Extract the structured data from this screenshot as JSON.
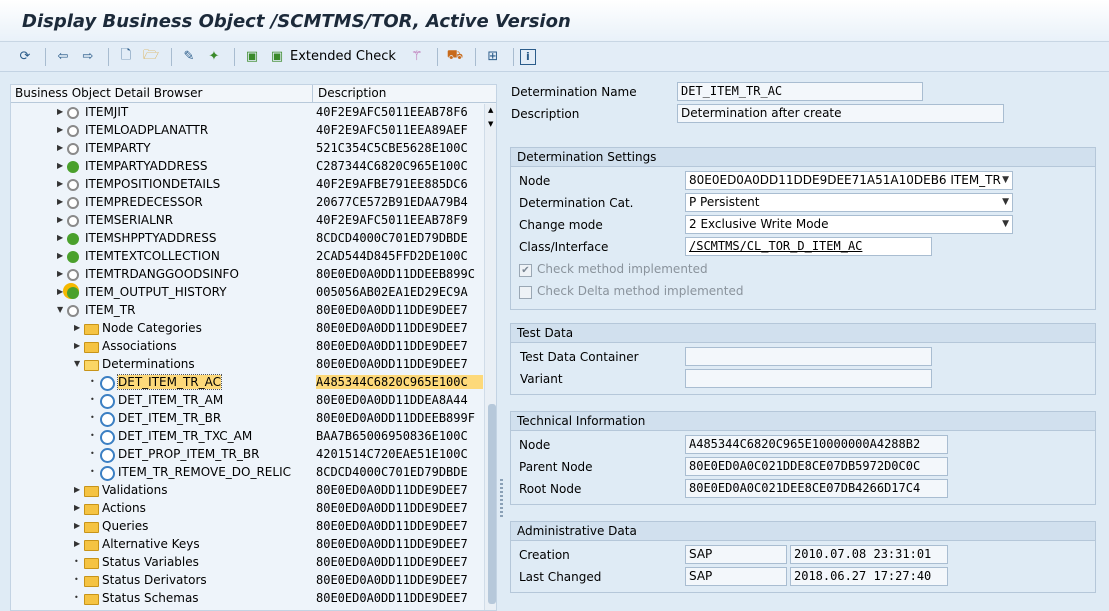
{
  "window": {
    "title": "Display Business Object /SCMTMS/TOR, Active Version"
  },
  "toolbar": {
    "extended_check_label": "Extended Check"
  },
  "tree": {
    "col_header": "Business Object Detail Browser",
    "desc_header": "Description",
    "rows": [
      {
        "label": "ITEMJIT",
        "desc": "40F2E9AFC5011EEAB78F6"
      },
      {
        "label": "ITEMLOADPLANATTR",
        "desc": "40F2E9AFC5011EEA89AEF"
      },
      {
        "label": "ITEMPARTY",
        "desc": "521C354C5CBE5628E100C"
      },
      {
        "label": "ITEMPARTYADDRESS",
        "desc": "C287344C6820C965E100C"
      },
      {
        "label": "ITEMPOSITIONDETAILS",
        "desc": "40F2E9AFBE791EE885DC6"
      },
      {
        "label": "ITEMPREDECESSOR",
        "desc": "20677CE572B91EDAA79B4"
      },
      {
        "label": "ITEMSERIALNR",
        "desc": "40F2E9AFC5011EEAB78F9"
      },
      {
        "label": "ITEMSHPPTYADDRESS",
        "desc": "8CDCD4000C701ED79DBDE"
      },
      {
        "label": "ITEMTEXTCOLLECTION",
        "desc": "2CAD544D845FFD2DE100C"
      },
      {
        "label": "ITEMTRDANGGOODSINFO",
        "desc": "80E0ED0A0DD11DDEEB899C"
      },
      {
        "label": "ITEM_OUTPUT_HISTORY",
        "desc": "005056AB02EA1ED29EC9A"
      },
      {
        "label": "ITEM_TR",
        "desc": "80E0ED0A0DD11DDE9DEE7"
      },
      {
        "label": "Node Categories",
        "desc": "80E0ED0A0DD11DDE9DEE7"
      },
      {
        "label": "Associations",
        "desc": "80E0ED0A0DD11DDE9DEE7"
      },
      {
        "label": "Determinations",
        "desc": "80E0ED0A0DD11DDE9DEE7"
      },
      {
        "label": "DET_ITEM_TR_AC",
        "desc": "A485344C6820C965E100C"
      },
      {
        "label": "DET_ITEM_TR_AM",
        "desc": "80E0ED0A0DD11DDEA8A44"
      },
      {
        "label": "DET_ITEM_TR_BR",
        "desc": "80E0ED0A0DD11DDEEB899F"
      },
      {
        "label": "DET_ITEM_TR_TXC_AM",
        "desc": "BAA7B65006950836E100C"
      },
      {
        "label": "DET_PROP_ITEM_TR_BR",
        "desc": "4201514C720EAE51E100C"
      },
      {
        "label": "ITEM_TR_REMOVE_DO_RELIC",
        "desc": "8CDCD4000C701ED79DBDE"
      },
      {
        "label": "Validations",
        "desc": "80E0ED0A0DD11DDE9DEE7"
      },
      {
        "label": "Actions",
        "desc": "80E0ED0A0DD11DDE9DEE7"
      },
      {
        "label": "Queries",
        "desc": "80E0ED0A0DD11DDE9DEE7"
      },
      {
        "label": "Alternative Keys",
        "desc": "80E0ED0A0DD11DDE9DEE7"
      },
      {
        "label": "Status Variables",
        "desc": "80E0ED0A0DD11DDE9DEE7"
      },
      {
        "label": "Status Derivators",
        "desc": "80E0ED0A0DD11DDE9DEE7"
      },
      {
        "label": "Status Schemas",
        "desc": "80E0ED0A0DD11DDE9DEE7"
      }
    ]
  },
  "detail": {
    "det_name_label": "Determination Name",
    "det_name_value": "DET_ITEM_TR_AC",
    "description_label": "Description",
    "description_value": "Determination after create",
    "settings": {
      "header": "Determination Settings",
      "node_label": "Node",
      "node_value": "80E0ED0A0DD11DDE9DEE71A51A10DEB6 ITEM_TR",
      "cat_label": "Determination Cat.",
      "cat_value": "P Persistent",
      "change_label": "Change mode",
      "change_value": "2 Exclusive Write Mode",
      "class_label": "Class/Interface",
      "class_value": "/SCMTMS/CL_TOR_D_ITEM_AC",
      "check_method": "Check method implemented",
      "check_delta": "Check Delta method implemented"
    },
    "test": {
      "header": "Test Data",
      "container_label": "Test Data Container",
      "container_value": "",
      "variant_label": "Variant",
      "variant_value": ""
    },
    "tech": {
      "header": "Technical Information",
      "node_label": "Node",
      "node_value": "A485344C6820C965E10000000A4288B2",
      "parent_label": "Parent Node",
      "parent_value": "80E0ED0A0C021DDE8CE07DB5972D0C0C",
      "root_label": "Root Node",
      "root_value": "80E0ED0A0C021DEE8CE07DB4266D17C4"
    },
    "admin": {
      "header": "Administrative Data",
      "creation_label": "Creation",
      "creation_user": "SAP",
      "creation_ts": "2010.07.08 23:31:01",
      "changed_label": "Last Changed",
      "changed_user": "SAP",
      "changed_ts": "2018.06.27 17:27:40"
    }
  }
}
